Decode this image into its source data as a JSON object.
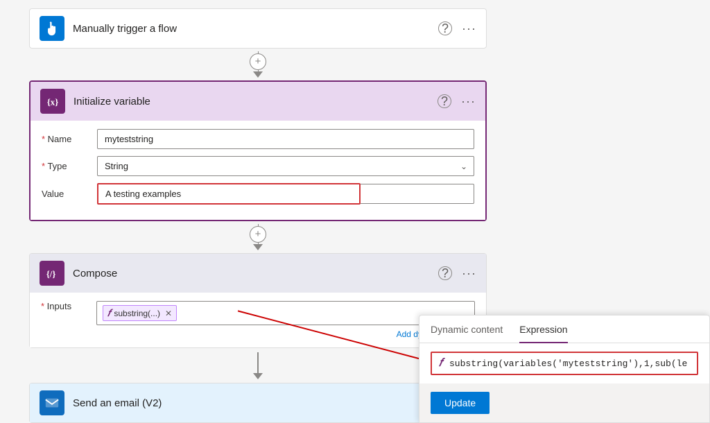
{
  "trigger": {
    "title": "Manually trigger a flow",
    "icon": "hand-icon",
    "icon_bg": "#0078d4"
  },
  "connector1": {
    "plus_label": "+"
  },
  "init_var": {
    "title": "Initialize variable",
    "icon": "variable-icon",
    "icon_bg": "#742774",
    "fields": {
      "name_label": "Name",
      "name_value": "myteststring",
      "type_label": "Type",
      "type_value": "String",
      "value_label": "Value",
      "value_value": "A testing examples"
    }
  },
  "connector2": {
    "plus_label": "+"
  },
  "compose": {
    "title": "Compose",
    "icon": "compose-icon",
    "icon_bg": "#742774",
    "inputs_label": "Inputs",
    "fx_tag": "substring(...)",
    "dynamic_content_link": "Add dynamic cont..."
  },
  "connector3": {
    "arrow_only": true
  },
  "email": {
    "title": "Send an email (V2)",
    "icon": "email-icon",
    "icon_bg": "#0f6cbd"
  },
  "expression_panel": {
    "tab_dynamic": "Dynamic content",
    "tab_expression": "Expression",
    "active_tab": "Expression",
    "expr_text": "substring(variables('myteststring'),1,sub(le",
    "update_btn": "Update"
  },
  "help_label": "?",
  "more_label": "···"
}
